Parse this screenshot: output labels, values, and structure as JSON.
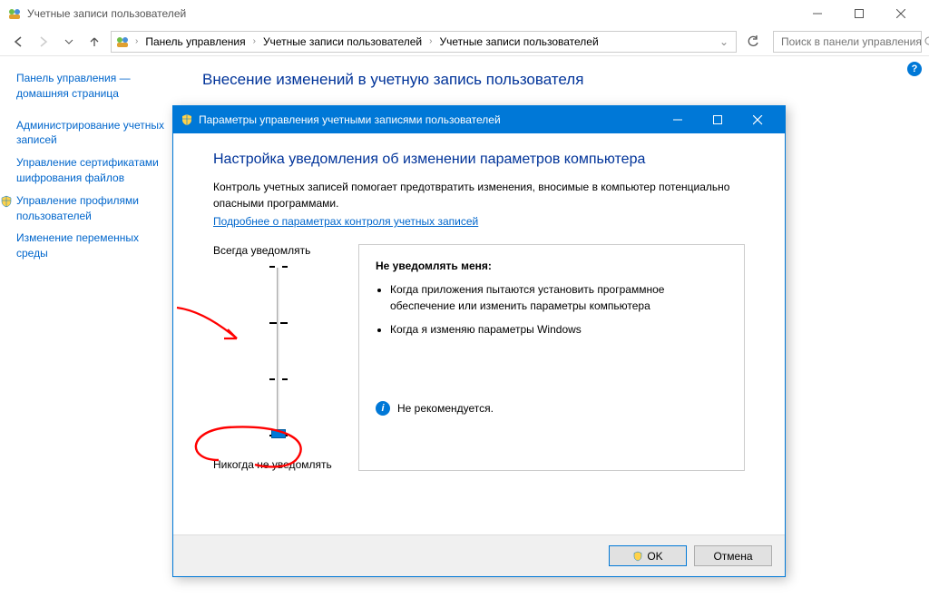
{
  "window": {
    "title": "Учетные записи пользователей",
    "breadcrumb": [
      "Панель управления",
      "Учетные записи пользователей",
      "Учетные записи пользователей"
    ],
    "search_placeholder": "Поиск в панели управления"
  },
  "sidebar": {
    "links": [
      "Панель управления — домашняя страница",
      "Администрирование учетных записей",
      "Управление сертификатами шифрования файлов",
      "Управление профилями пользователей",
      "Изменение переменных среды"
    ]
  },
  "main": {
    "heading": "Внесение изменений в учетную запись пользователя"
  },
  "dialog": {
    "title": "Параметры управления учетными записями пользователей",
    "heading": "Настройка уведомления об изменении параметров компьютера",
    "desc": "Контроль учетных записей помогает предотвратить изменения, вносимые в компьютер потенциально опасными программами.",
    "link": "Подробнее о параметрах контроля учетных записей",
    "slider_top": "Всегда уведомлять",
    "slider_bottom": "Никогда не уведомлять",
    "info_heading": "Не уведомлять меня:",
    "bullets": [
      "Когда приложения пытаются установить программное обеспечение или изменить параметры компьютера",
      "Когда я изменяю параметры Windows"
    ],
    "info_foot": "Не рекомендуется.",
    "ok": "OK",
    "cancel": "Отмена"
  }
}
